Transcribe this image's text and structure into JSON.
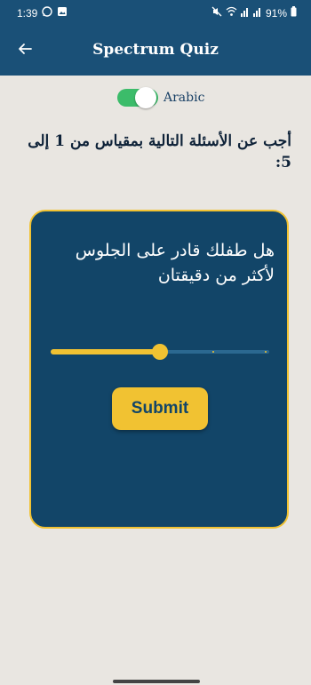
{
  "status_bar": {
    "time": "1:39",
    "battery": "91%",
    "left_icons": [
      "whatsapp-icon",
      "image-icon"
    ],
    "right_icons": [
      "mute-icon",
      "wifi-icon",
      "signal-icon",
      "signal-icon",
      "battery-icon"
    ]
  },
  "app_bar": {
    "title": "Spectrum Quiz",
    "back_icon": "arrow-left-icon"
  },
  "language_toggle": {
    "label": "Arabic",
    "on": true
  },
  "instruction": "أجب عن الأسئلة التالية بمقياس من 1 إلى 5:",
  "question_card": {
    "question": "هل طفلك قادر على الجلوس لأكثر من دقيقتان",
    "slider": {
      "min": 1,
      "max": 5,
      "value": 3
    },
    "submit_label": "Submit"
  },
  "colors": {
    "primary": "#1a5077",
    "card": "#124568",
    "accent": "#f1c232",
    "toggle_on": "#3cbc6a",
    "background": "#e9e6e1"
  }
}
